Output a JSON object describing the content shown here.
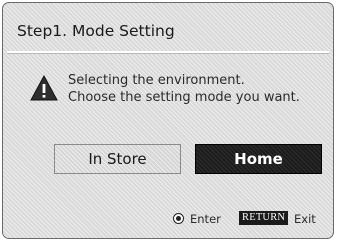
{
  "dialog": {
    "title": "Step1. Mode Setting",
    "icon": "warning-icon",
    "message_lines": [
      "Selecting the environment.",
      "Choose the setting mode you want."
    ],
    "buttons": {
      "in_store": "In Store",
      "home": "Home",
      "selected": "Home"
    },
    "footer": {
      "enter_icon": "ok-button-icon",
      "enter_label": "Enter",
      "return_key": "RETURN",
      "exit_label": "Exit"
    }
  },
  "colors": {
    "selected_button": "#1c1c1c",
    "panel": "#d9d9d9"
  }
}
